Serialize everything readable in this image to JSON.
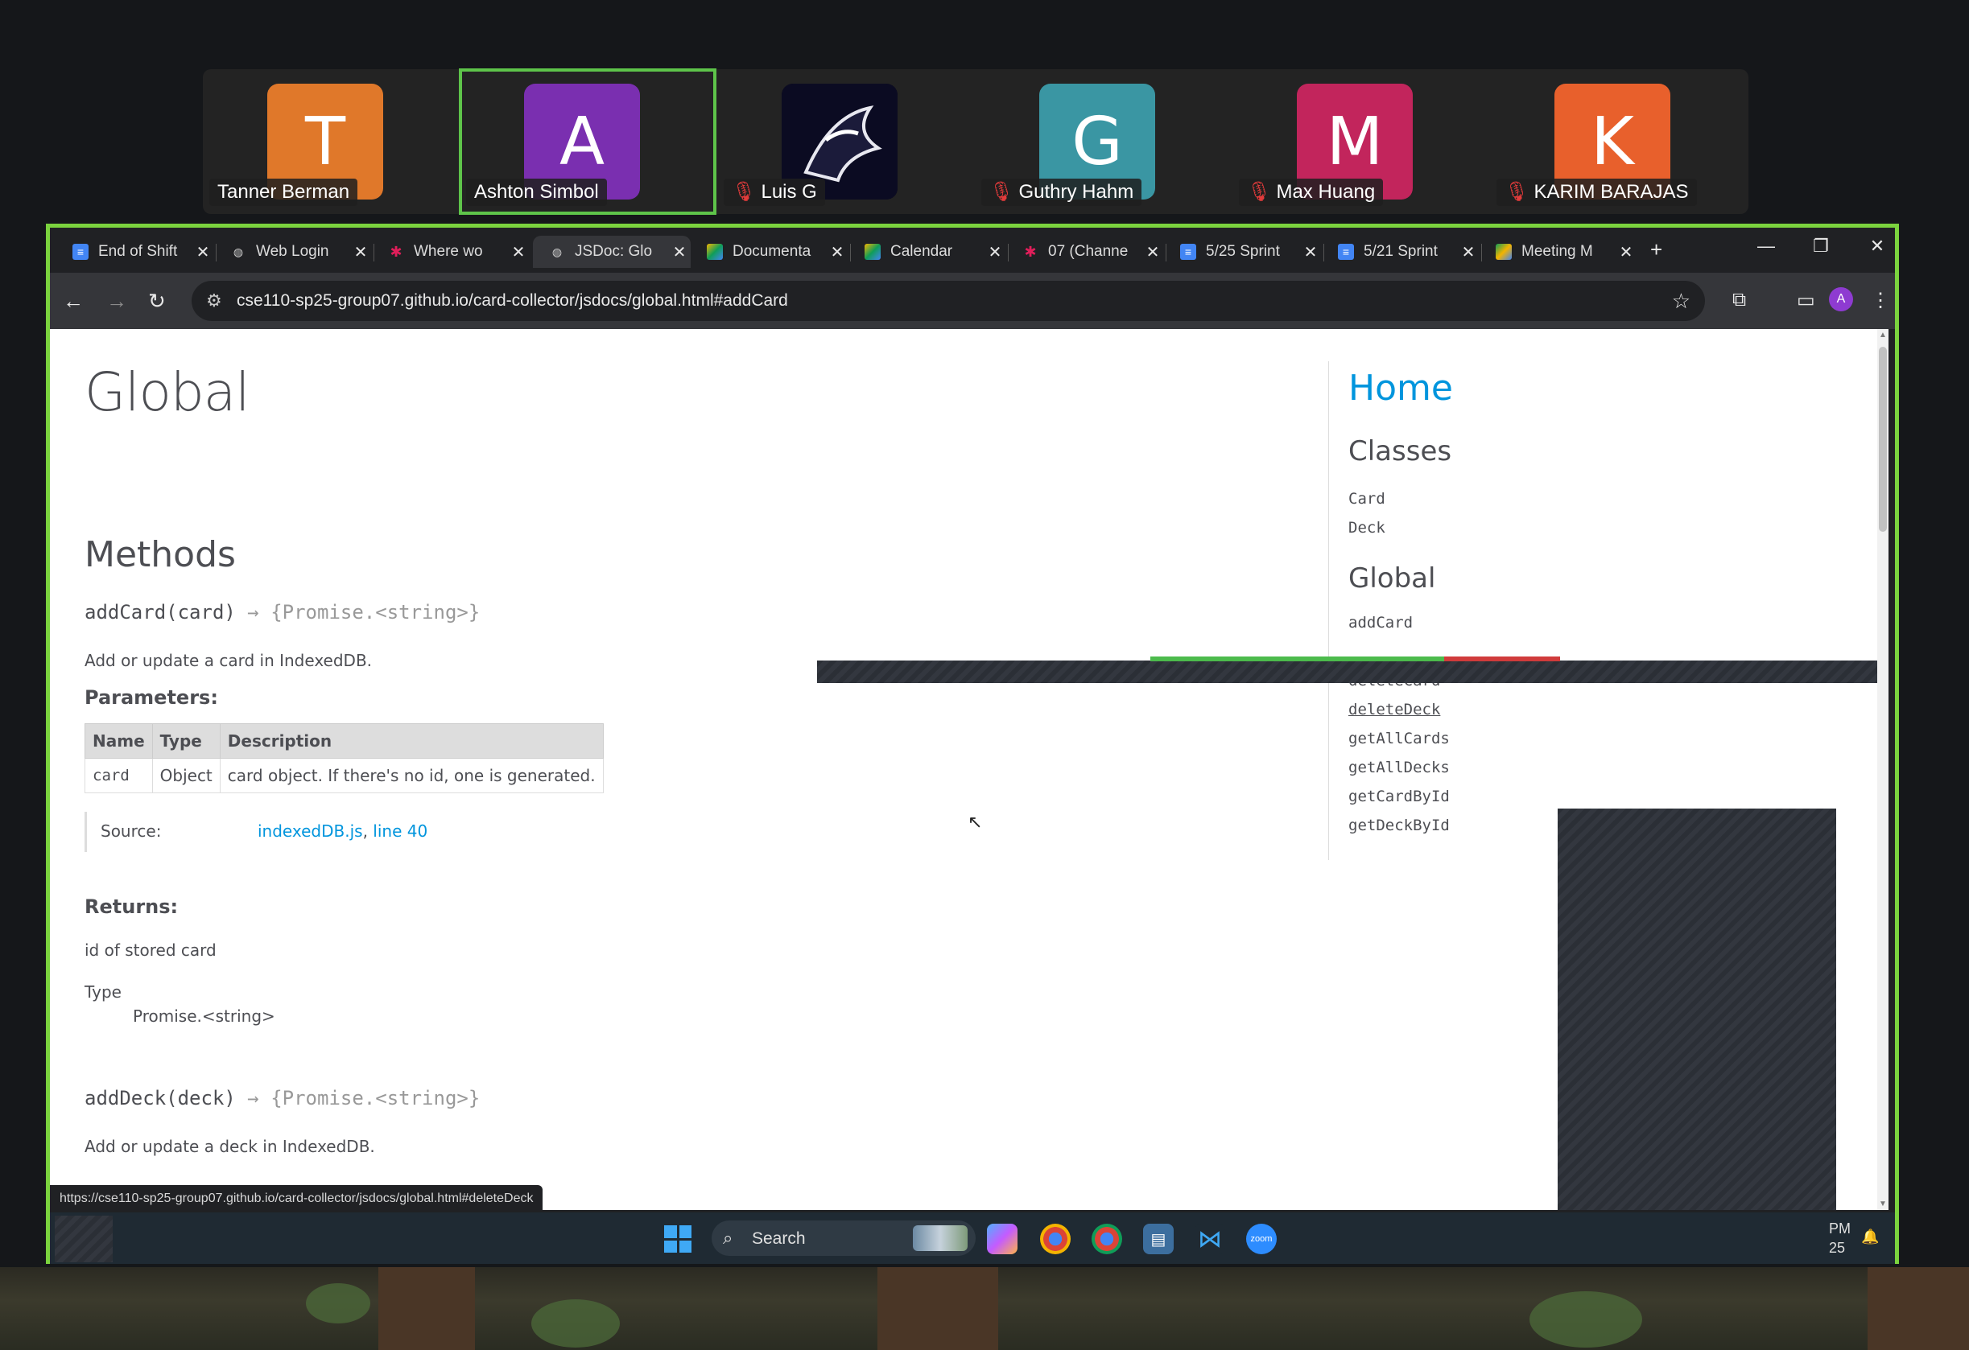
{
  "participants": [
    {
      "initial": "T",
      "name": "Tanner Berman",
      "color": "#e0782a",
      "muted": false,
      "active": false
    },
    {
      "initial": "A",
      "name": "Ashton Simbol",
      "color": "#7a2fb0",
      "muted": false,
      "active": true
    },
    {
      "initial": "",
      "name": "Luis G",
      "color": "#0b0b1a",
      "muted": true,
      "active": false
    },
    {
      "initial": "G",
      "name": "Guthry Hahm",
      "color": "#3a96a3",
      "muted": true,
      "active": false
    },
    {
      "initial": "M",
      "name": "Max Huang",
      "color": "#c2255c",
      "muted": true,
      "active": false
    },
    {
      "initial": "K",
      "name": "KARIM BARAJAS",
      "color": "#e8602c",
      "muted": true,
      "active": false
    }
  ],
  "browser": {
    "tabs": [
      {
        "title": "End of Shift",
        "icon": "google-docs-icon",
        "color": "#4285f4"
      },
      {
        "title": "Web Login",
        "icon": "globe-icon",
        "color": "#9aa0a6"
      },
      {
        "title": "Where wo",
        "icon": "slack-icon",
        "color": "#e01e5a"
      },
      {
        "title": "JSDoc: Glo",
        "icon": "globe-icon",
        "color": "#9aa0a6"
      },
      {
        "title": "Documenta",
        "icon": "drive-icon",
        "color": "#f4b400"
      },
      {
        "title": "Calendar",
        "icon": "drive-icon",
        "color": "#f4b400"
      },
      {
        "title": "07 (Channe",
        "icon": "slack-icon",
        "color": "#e01e5a"
      },
      {
        "title": "5/25 Sprint",
        "icon": "google-docs-icon",
        "color": "#4285f4"
      },
      {
        "title": "5/21 Sprint",
        "icon": "google-docs-icon",
        "color": "#4285f4"
      },
      {
        "title": "Meeting M",
        "icon": "drive-icon",
        "color": "#0f9d58"
      }
    ],
    "url": "cse110-sp25-group07.github.io/card-collector/jsdocs/global.html#addCard",
    "profile_initial": "A",
    "status_url": "https://cse110-sp25-group07.github.io/card-collector/jsdocs/global.html#deleteDeck"
  },
  "doc": {
    "title": "Global",
    "methods_heading": "Methods",
    "m1": {
      "name": "addCard(card)",
      "arrow": "→",
      "returns": "{Promise.<string>}",
      "desc": "Add or update a card in IndexedDB."
    },
    "parameters_heading": "Parameters:",
    "table": {
      "headers": [
        "Name",
        "Type",
        "Description"
      ],
      "rows": [
        [
          "card",
          "Object",
          "card object. If there's no id, one is generated."
        ]
      ]
    },
    "source_label": "Source:",
    "source_file": "indexedDB.js",
    "source_sep": ", ",
    "source_line": "line 40",
    "returns_heading": "Returns:",
    "returns_desc": "id of stored card",
    "type_label": "Type",
    "type_value": "Promise.<string>",
    "m2": {
      "name": "addDeck(deck)",
      "arrow": "→",
      "returns": "{Promise.<string>}",
      "desc": "Add or update a deck in IndexedDB."
    }
  },
  "nav": {
    "home": "Home",
    "classes_heading": "Classes",
    "classes": [
      "Card",
      "Deck"
    ],
    "global_heading": "Global",
    "global_items": [
      "addCard",
      "deleteCard",
      "deleteDeck",
      "getAllCards",
      "getAllDecks",
      "getCardById",
      "getDeckById"
    ]
  },
  "taskbar": {
    "search": "Search",
    "tray_time": "PM",
    "tray_date": "25"
  }
}
